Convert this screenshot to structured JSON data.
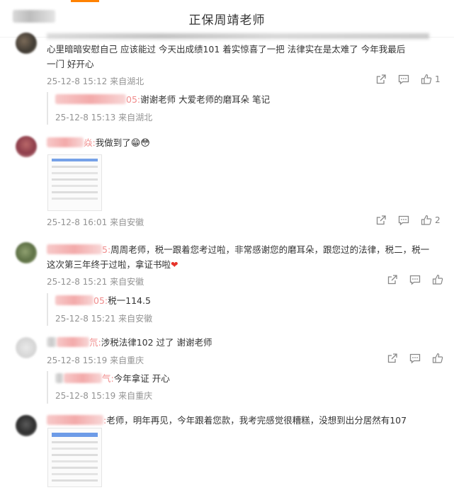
{
  "header": {
    "title": "正保周靖老师"
  },
  "comments": [
    {
      "text_line1": "心里暗暗安慰自己 应该能过   今天出成绩101   着实惊喜了一把   法律实在是太难了   今年我最后",
      "text_line2": "一门   好开心",
      "time": "25-12-8 15:12",
      "location": "来自湖北",
      "like_count": "1",
      "replies": [
        {
          "name_tail": "05:",
          "text": "谢谢老师   大爱老师的磨耳朵  笔记",
          "time": "25-12-8 15:13",
          "location": "来自湖北"
        }
      ]
    },
    {
      "name_tail": "焱:",
      "text": "我做到了",
      "emoji": "😁😳",
      "time": "25-12-8 16:01",
      "location": "来自安徽",
      "like_count": "2"
    },
    {
      "name_tail": "5:",
      "text_line1": "周周老师，税一跟着您考过啦，非常感谢您的磨耳朵，跟您过的法律，税二，税一",
      "text_line2": "这次第三年终于过啦，拿证书啦",
      "heart": "❤",
      "time": "25-12-8 15:21",
      "location": "来自安徽",
      "replies": [
        {
          "name_tail": "05:",
          "text": "税一114.5",
          "time": "25-12-8 15:21",
          "location": "来自安徽"
        }
      ]
    },
    {
      "name_tail": "氘:",
      "text": "涉税法律102 过了 谢谢老师",
      "time": "25-12-8 15:19",
      "location": "来自重庆",
      "replies": [
        {
          "name_tail": "气:",
          "text": "今年拿证 开心",
          "time": "25-12-8 15:19",
          "location": "来自重庆"
        }
      ]
    },
    {
      "name_tail": ":",
      "text": "老师，明年再见，今年跟着您款，我考完感觉很糟糕，没想到出分居然有107"
    }
  ],
  "colors": {
    "accent": "#ff8200",
    "meta": "#939393",
    "heart": "#e6332a"
  },
  "icons": [
    "share-icon",
    "comment-icon",
    "like-icon"
  ]
}
